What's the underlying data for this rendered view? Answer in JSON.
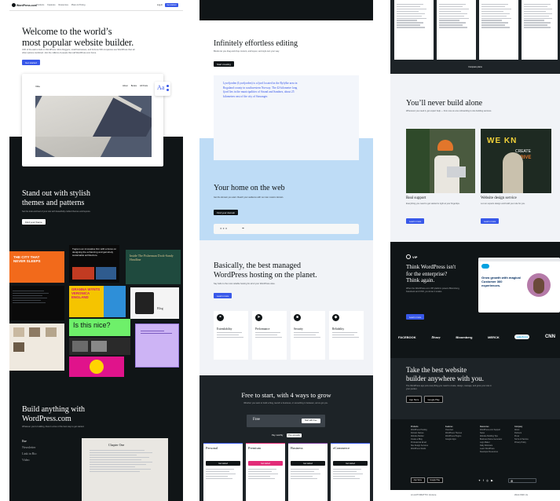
{
  "col1": {
    "logo": "WordPress.com",
    "nav": [
      "Products",
      "Features",
      "Resources",
      "Plans & Pricing"
    ],
    "login": "Log in",
    "get_started": "Get started",
    "hero_title_1": "Welcome to the world’s",
    "hero_title_2": "most popular website builder.",
    "hero_sub": "43% of the web is built on WordPress. More bloggers, small businesses, and Fortune 500 companies use WordPress than all other options combined. Join the millions of people that call WordPress.com home.",
    "hero_cta": "Get started",
    "mock_nav_brand": "Villa",
    "mock_nav_links": [
      "About",
      "Books",
      "All Posts"
    ],
    "mock_aa": "Aa",
    "themes_title_1": "Stand out with stylish",
    "themes_title_2": "themes and patterns",
    "themes_sub": "Set the look and feel of your site with beautifully crafted themes and layouts.",
    "themes_cta": "Find your theme",
    "tile_city": "THE CITY THAT NEVER SLEEPS",
    "tile_fiction": "Tugra is an innovative firm with a focus on designing the enhancing and genuinely sustainable architecture.",
    "tile_guide": "Inside The Fisherman Dock-Sandy Headline",
    "tile_veronica": "GRANNA WYNTS VERONICA ENGLAND",
    "tile_nice": "Is this nice?",
    "tile_blog": "Blog",
    "build_title_1": "Build anything with",
    "build_title_2": "WordPress.com",
    "build_sub": "Whatever you're building, there's a few of the best way to get started.",
    "build_menu": [
      "Ilse",
      "Newsletter",
      "Link in Bio",
      "Video"
    ],
    "build_page_title": "Chapter One"
  },
  "col2": {
    "edit_title": "Infinitely effortless editing",
    "edit_sub": "Blocks let you drag and drop content, and layout, and style text your way.",
    "edit_cta": "Start creating",
    "quote": "Lysefjorden (Lysefjorden) is a fjord located in the Ryfylke area in Rogaland county in southwestern Norway. The 42-kilometre long fjord lies in the municipalities of Strand and Sandnes, about 25 kilometres east of the city of Stavanger.",
    "home_title": "Your home on the web",
    "home_sub": "Get the domain you want. Reach your audience with our own custom domain.",
    "home_cta": "Find your domain",
    "domain_placeholder": "●●●",
    "hosting_title_1": "Basically, the best managed",
    "hosting_title_2": "WordPress hosting on the planet.",
    "hosting_sub": "Say hello to the most reliable hosting for all of your WordPress sites.",
    "hosting_cta": "Learn more",
    "features": [
      {
        "title": "Extendability",
        "icon": "plugin-icon"
      },
      {
        "title": "Performance",
        "icon": "speed-icon"
      },
      {
        "title": "Security",
        "icon": "lock-icon"
      },
      {
        "title": "Reliability",
        "icon": "shield-icon"
      }
    ],
    "pricing_title": "Free to start, with 4 ways to grow",
    "pricing_sub": "Whether you want to build a blog, launch a business, or something in between, we've got you.",
    "pricing_free": "Free",
    "pricing_free_cta": "Start with Free",
    "toggle": [
      "Pay monthly",
      "Pay annually"
    ],
    "plans": [
      {
        "name": "Personal",
        "color": "#3858e9"
      },
      {
        "name": "Premium",
        "color": "#e22c78"
      },
      {
        "name": "Business",
        "color": "#7a3e9d"
      },
      {
        "name": "eCommerce",
        "color": "#3858e9"
      }
    ],
    "plan_cta": "Get started"
  },
  "col3": {
    "compare_label": "Compare plans",
    "never_title": "You’ll never build alone",
    "never_sub": "Whenever you need it, get expert help — from one-on-one onboarding to site building services.",
    "card1_title": "Real support",
    "card1_text": "Everything you need to get started is right at your fingertips.",
    "card1_cta": "Learn more",
    "card2_title": "Website design service",
    "card2_text": "Let our experts design and build your site for you.",
    "card2_cta": "Learn more",
    "wpvip_logo": "VIP",
    "ent_title_1": "Think WordPress isn't",
    "ent_title_2": "for the enterprise?",
    "ent_title_3": "Think again.",
    "ent_sub": "When the WordPress.com VIP platform powers Bloomberg, Facebook and CNN, you know it scales.",
    "ent_cta": "Learn more",
    "ent_card_text": "Grow growth with magical Customer 360 experiences.",
    "logos": [
      "FACEBOOK",
      "Disney",
      "Bloomberg",
      "MERCK",
      "salesforce",
      "CNN"
    ],
    "cta_title_1": "Take the best website",
    "cta_title_2": "builder anywhere with you.",
    "cta_sub": "The WordPress app puts everything you need to create, design, manage, and grow your site in your pocket.",
    "store_badges": [
      "App Store",
      "Google Play"
    ],
    "footer_cols": [
      {
        "title": "Products",
        "items": [
          "WordPress Hosting",
          "Domain Names",
          "Website Builder",
          "Create a Blog",
          "Professional Email",
          "Site Design Services",
          "WordPress Studio"
        ]
      },
      {
        "title": "Features",
        "items": [
          "Overview",
          "WordPress Themes",
          "WordPress Plugins",
          "Google Apps"
        ]
      },
      {
        "title": "Resources",
        "items": [
          "WordPress.com Support",
          "News",
          "Website Building Tips",
          "Business Name Generator",
          "Logo Maker",
          "Daily Webinars",
          "Learn WordPress",
          "Developer Resources"
        ]
      },
      {
        "title": "Company",
        "items": [
          "About",
          "Partners",
          "Press",
          "Terms of Service",
          "Privacy Policy"
        ]
      }
    ],
    "footer_bottom_left": "An AUTOMATTIC Venture",
    "footer_bottom_right": "Work With Us"
  },
  "colors": {
    "accent": "#3858e9",
    "dark": "#101517",
    "light_blue": "#bedcf6",
    "pale": "#f1f3f7"
  }
}
